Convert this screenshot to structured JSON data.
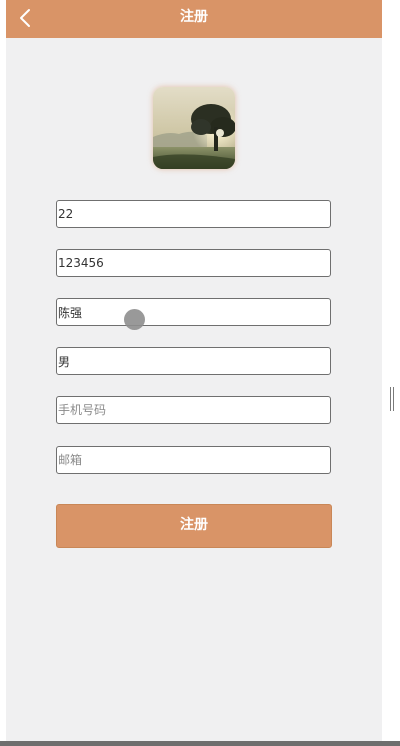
{
  "header": {
    "title": "注册",
    "background": "#d99467",
    "back_icon": "chevron-left-icon"
  },
  "avatar": {
    "icon": "landscape-tree-photo"
  },
  "form": {
    "fields": [
      {
        "name": "account",
        "value": "22",
        "placeholder": ""
      },
      {
        "name": "password",
        "value": "123456",
        "placeholder": ""
      },
      {
        "name": "name",
        "value": "陈强",
        "placeholder": ""
      },
      {
        "name": "gender",
        "value": "男",
        "placeholder": ""
      },
      {
        "name": "phone",
        "value": "",
        "placeholder": "手机号码"
      },
      {
        "name": "email",
        "value": "",
        "placeholder": "邮箱"
      }
    ],
    "submit_label": "注册"
  },
  "colors": {
    "accent": "#d99467",
    "page_background": "#f0f0f1"
  }
}
